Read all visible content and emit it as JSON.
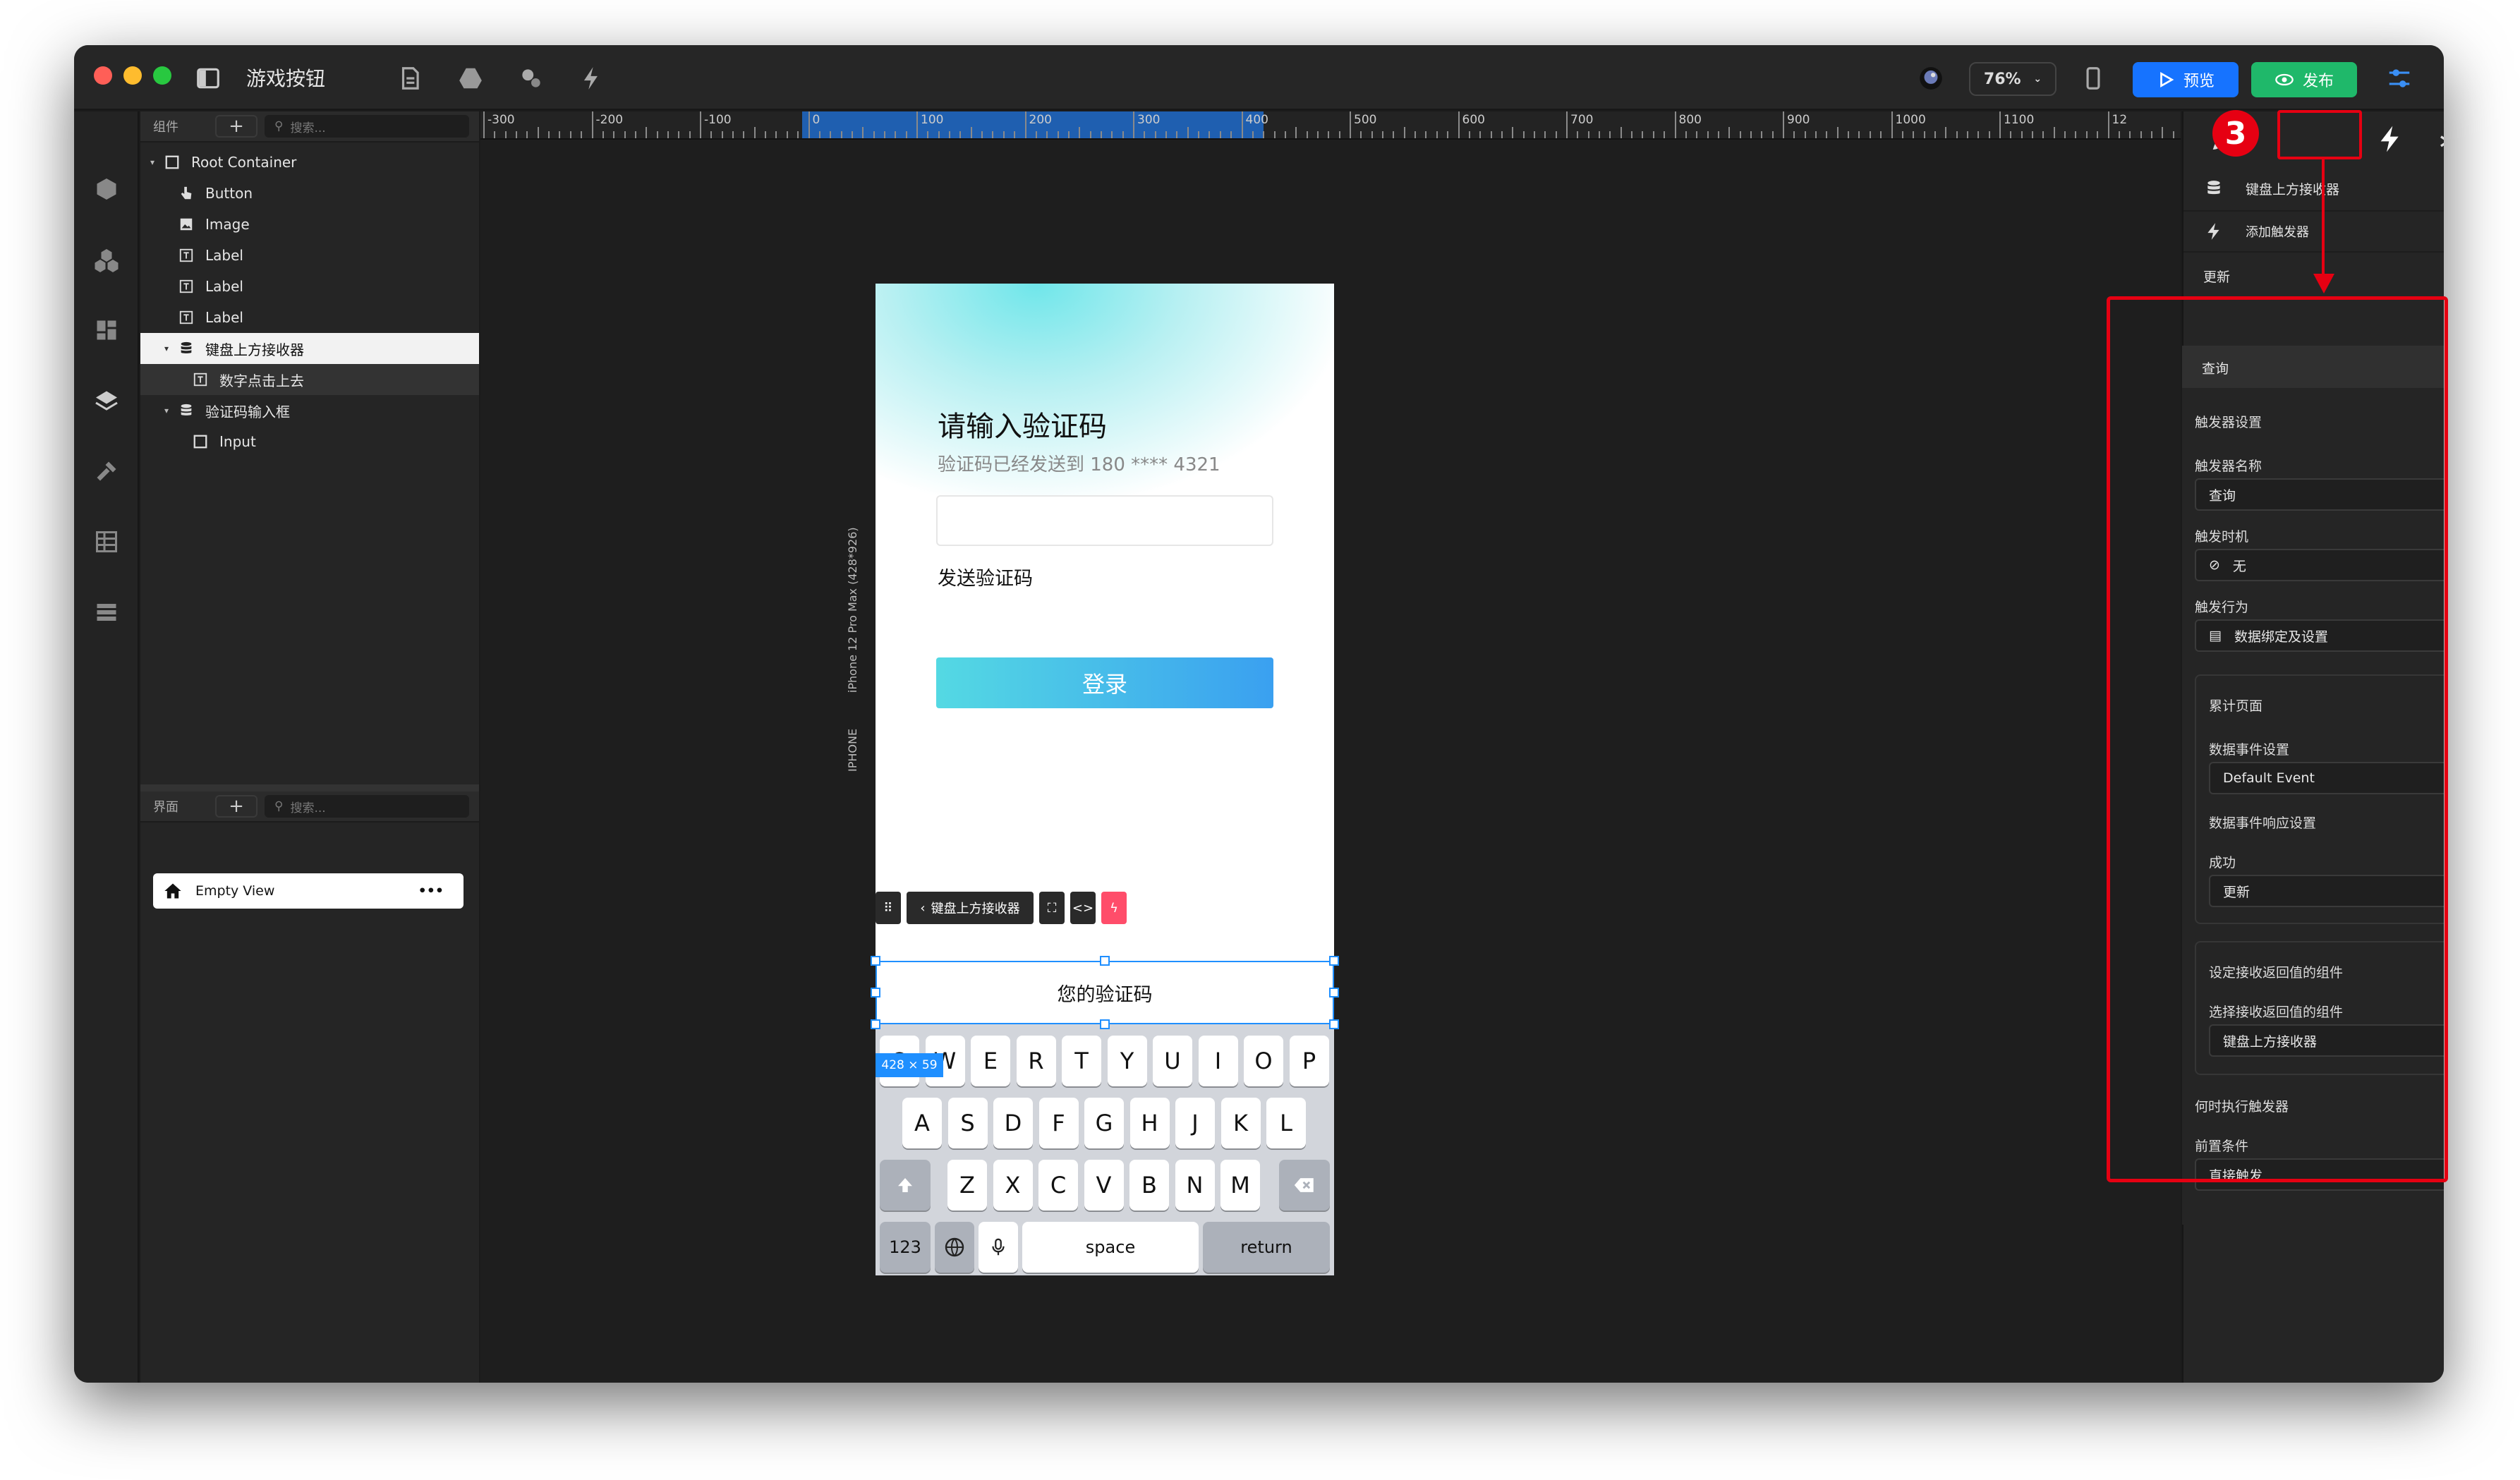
{
  "app": {
    "title": "游戏按钮",
    "zoom": "76%",
    "preview": "预览",
    "publish": "发布"
  },
  "left": {
    "components_label": "组件",
    "search_placeholder": "搜索...",
    "tree": [
      {
        "label": "Root Container",
        "icon": "square-icon"
      },
      {
        "label": "Button",
        "icon": "hand-pointer-icon"
      },
      {
        "label": "Image",
        "icon": "image-icon"
      },
      {
        "label": "Label",
        "icon": "text-icon"
      },
      {
        "label": "Label",
        "icon": "text-icon"
      },
      {
        "label": "Label",
        "icon": "text-icon"
      },
      {
        "label": "键盘上方接收器",
        "icon": "database-icon"
      },
      {
        "label": "数字点击上去",
        "icon": "text-icon"
      },
      {
        "label": "验证码输入框",
        "icon": "database-icon"
      },
      {
        "label": "Input",
        "icon": "square-icon"
      }
    ],
    "screens_label": "界面",
    "screen_item": "Empty View",
    "screen_more": "•••"
  },
  "ruler": [
    "-300",
    "-200",
    "-100",
    "0",
    "100",
    "200",
    "300",
    "400",
    "500",
    "600",
    "700",
    "800",
    "900",
    "1000",
    "1100",
    "12"
  ],
  "phone": {
    "device_label": "IPHONE",
    "device_model": "iPhone 12 Pro Max (428*926)",
    "title": "请输入验证码",
    "subtitle": "验证码已经发送到 180 **** 4321",
    "send_code": "发送验证码",
    "login": "登录",
    "toolbar_component": "键盘上方接收器",
    "receiver_text": "您的验证码",
    "size_badge": "428 × 59",
    "keyboard": {
      "row1": [
        "Q",
        "W",
        "E",
        "R",
        "T",
        "Y",
        "U",
        "I",
        "O",
        "P"
      ],
      "row2": [
        "A",
        "S",
        "D",
        "F",
        "G",
        "H",
        "J",
        "K",
        "L"
      ],
      "row3": [
        "Z",
        "X",
        "C",
        "V",
        "B",
        "N",
        "M"
      ],
      "num": "123",
      "space": "space",
      "return": "return"
    }
  },
  "right": {
    "component_name": "键盘上方接收器",
    "add_trigger": "添加触发器",
    "update": "更新",
    "query": "查询",
    "trigger_settings": "触发器设置",
    "trigger_name_label": "触发器名称",
    "trigger_name_value": "查询",
    "trigger_timing_label": "触发时机",
    "trigger_timing_value": "无",
    "trigger_action_label": "触发行为",
    "trigger_action_value": "数据绑定及设置",
    "accumulate_page": "累计页面",
    "data_event_label": "数据事件设置",
    "data_event_value": "Default Event",
    "data_event_response": "数据事件响应设置",
    "success_label": "成功",
    "success_value": "更新",
    "set_receiver": "设定接收返回值的组件",
    "select_receiver_label": "选择接收返回值的组件",
    "select_receiver_value": "键盘上方接收器",
    "when_exec": "何时执行触发器",
    "precondition_label": "前置条件",
    "precondition_value": "直接触发"
  },
  "annotation": {
    "step_number": "3",
    "color": "#e60012"
  },
  "colors": {
    "accent_blue": "#1673ff",
    "publish_green": "#1fb86a",
    "login_gradient_start": "#54d9e3",
    "login_gradient_end": "#3aa0f0"
  }
}
